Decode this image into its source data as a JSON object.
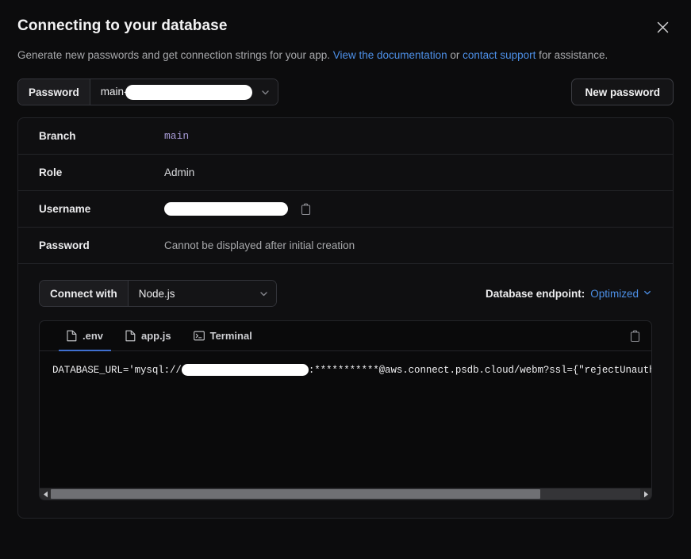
{
  "modal": {
    "title": "Connecting to your database",
    "subtitle_part1": "Generate new passwords and get connection strings for your app. ",
    "link_docs": "View the documentation",
    "subtitle_or": " or ",
    "link_support": "contact support",
    "subtitle_part2": " for assistance.",
    "close_icon": "close-icon"
  },
  "password_selector": {
    "label": "Password",
    "value_prefix": "main-",
    "value_redacted": true,
    "chevron_icon": "chevron-down-icon"
  },
  "new_password_button": {
    "label": "New password"
  },
  "details": {
    "rows": [
      {
        "key": "Branch",
        "value": "main",
        "style": "mono-purple",
        "copy": false
      },
      {
        "key": "Role",
        "value": "Admin",
        "style": "plain",
        "copy": false
      },
      {
        "key": "Username",
        "value": "",
        "style": "redacted",
        "copy": true,
        "copy_icon": "clipboard-icon"
      },
      {
        "key": "Password",
        "value": "Cannot be displayed after initial creation",
        "style": "muted",
        "copy": false
      }
    ]
  },
  "connect": {
    "label": "Connect with",
    "language": "Node.js",
    "chevron_icon": "chevron-down-icon",
    "endpoint_label": "Database endpoint:",
    "endpoint_value": "Optimized",
    "endpoint_chevron_icon": "chevron-down-icon"
  },
  "code_panel": {
    "tabs": [
      {
        "label": ".env",
        "icon": "file-icon",
        "active": true
      },
      {
        "label": "app.js",
        "icon": "file-icon",
        "active": false
      },
      {
        "label": "Terminal",
        "icon": "terminal-icon",
        "active": false
      }
    ],
    "copy_icon": "clipboard-icon",
    "code_prefix": "DATABASE_URL='mysql://",
    "code_suffix": ":***********@aws.connect.psdb.cloud/webm?ssl={\"rejectUnauthorized\":true}'",
    "scrollbar": {
      "left_arrow_icon": "caret-left-icon",
      "right_arrow_icon": "caret-right-icon",
      "thumb_percent": 83
    }
  },
  "colors": {
    "page_bg": "#0c0c0d",
    "link": "#4d90e8",
    "accent_underline": "#3f6fd0",
    "branch_value": "#a79bd6",
    "border": "#232428"
  }
}
